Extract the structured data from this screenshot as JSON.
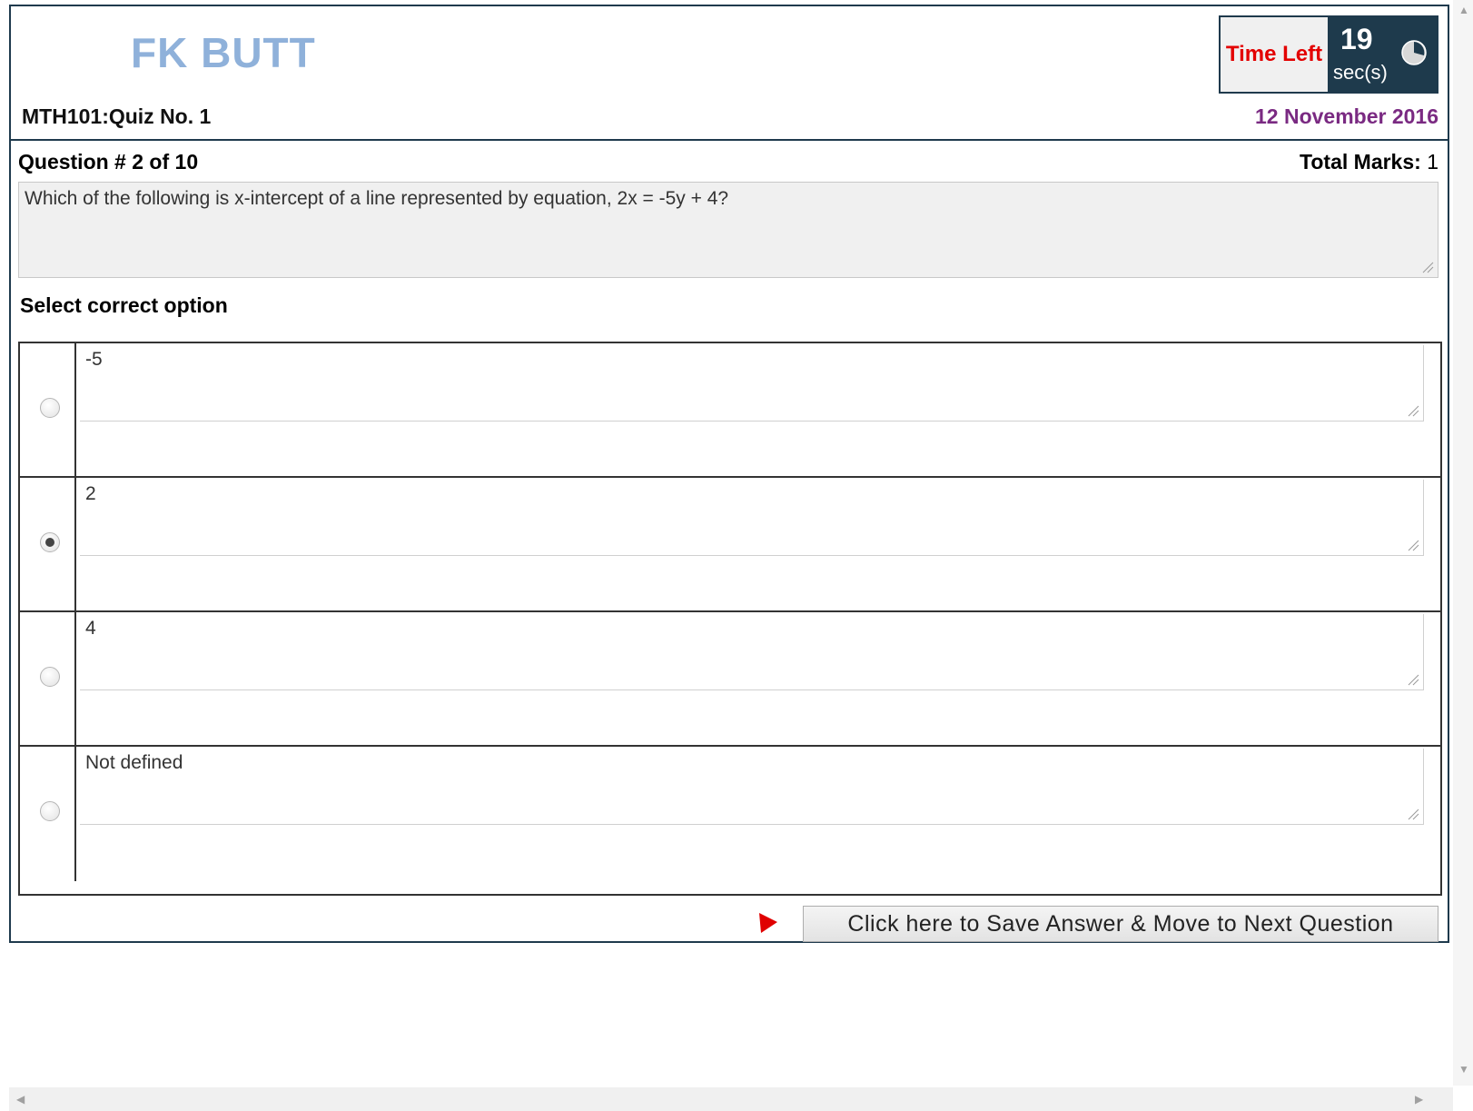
{
  "header": {
    "student_name": "FK BUTT",
    "quiz_title": "MTH101:Quiz No. 1",
    "date": "12 November 2016",
    "timer": {
      "label": "Time Left",
      "seconds": "19",
      "unit": "sec(s)"
    }
  },
  "question": {
    "number_label": "Question # 2 of 10",
    "total_marks_label": "Total Marks:",
    "total_marks_value": "1",
    "text": "Which of the following is x-intercept of a line represented by equation, 2x = -5y + 4?"
  },
  "select_label": "Select correct option",
  "options": [
    {
      "text": "-5",
      "selected": false
    },
    {
      "text": "2",
      "selected": true
    },
    {
      "text": "4",
      "selected": false
    },
    {
      "text": "Not defined",
      "selected": false
    }
  ],
  "footer": {
    "next_button_label": "Click here to Save Answer & Move to Next Question",
    "arrow_icon": "play-arrow-icon"
  },
  "colors": {
    "header_border": "#1f3a4d",
    "student_name": "#8fb1da",
    "date": "#7a2a82",
    "timer_label": "#e30000",
    "timer_bg": "#1e3a4c"
  }
}
